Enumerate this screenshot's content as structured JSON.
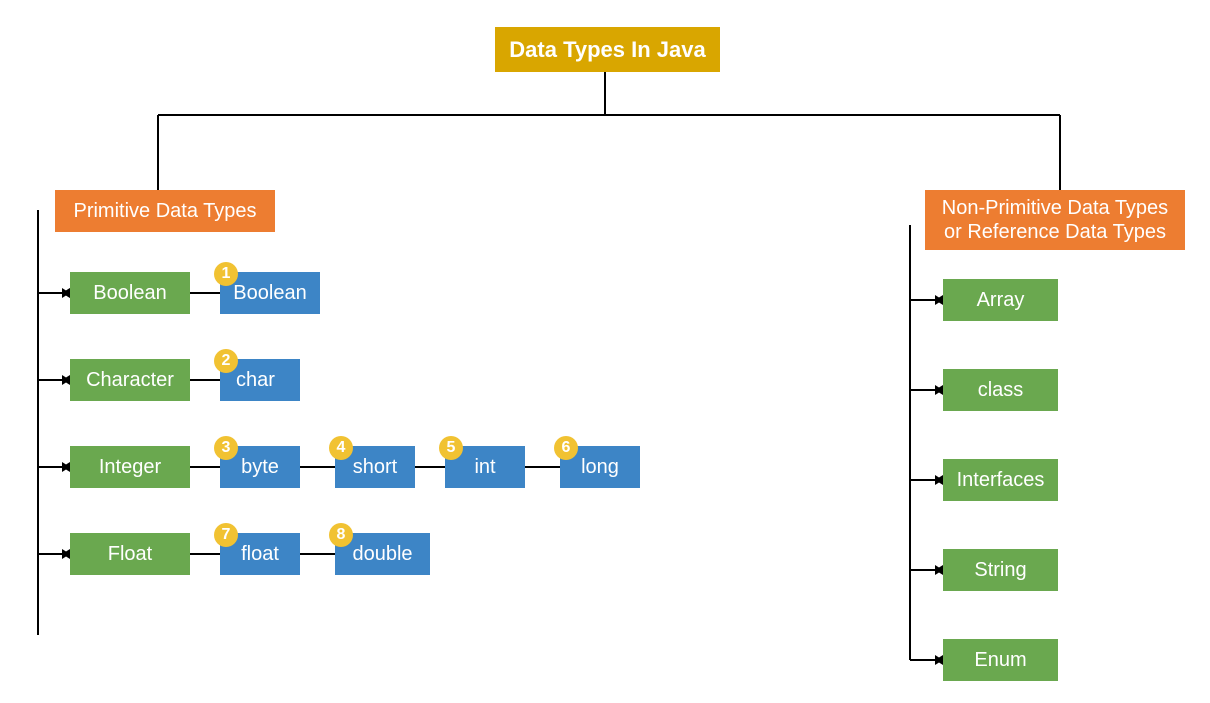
{
  "root": {
    "title": "Data Types In Java"
  },
  "branches": {
    "primitive": {
      "label": "Primitive Data Types"
    },
    "nonprimitive": {
      "label": "Non-Primitive Data Types\nor Reference Data Types"
    }
  },
  "primitive_categories": [
    {
      "name": "Boolean",
      "leaves": [
        {
          "num": "1",
          "label": "Boolean"
        }
      ]
    },
    {
      "name": "Character",
      "leaves": [
        {
          "num": "2",
          "label": "char"
        }
      ]
    },
    {
      "name": "Integer",
      "leaves": [
        {
          "num": "3",
          "label": "byte"
        },
        {
          "num": "4",
          "label": "short"
        },
        {
          "num": "5",
          "label": "int"
        },
        {
          "num": "6",
          "label": "long"
        }
      ]
    },
    {
      "name": "Float",
      "leaves": [
        {
          "num": "7",
          "label": "float"
        },
        {
          "num": "8",
          "label": "double"
        }
      ]
    }
  ],
  "nonprimitive_items": [
    {
      "label": "Array"
    },
    {
      "label": "class"
    },
    {
      "label": "Interfaces"
    },
    {
      "label": "String"
    },
    {
      "label": "Enum"
    }
  ]
}
